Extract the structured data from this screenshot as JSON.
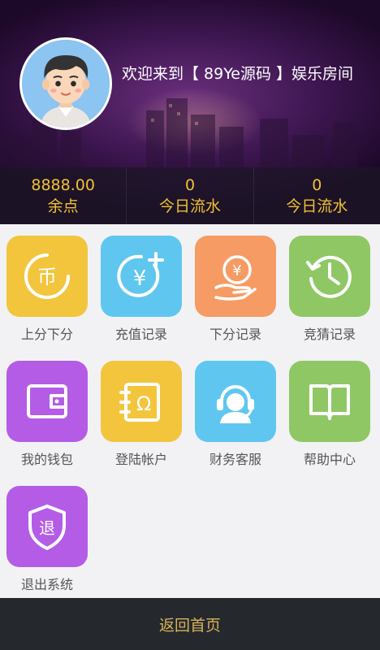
{
  "header": {
    "welcome": "欢迎来到【 89Ye源码 】娱乐房间"
  },
  "stats": [
    {
      "value": "8888.00",
      "label": "余点"
    },
    {
      "value": "0",
      "label": "今日流水"
    },
    {
      "value": "0",
      "label": "今日流水"
    }
  ],
  "menu": [
    {
      "label": "上分下分",
      "icon": "coin-icon",
      "color": "#f2c53d"
    },
    {
      "label": "充值记录",
      "icon": "yen-plus-icon",
      "color": "#5fc7ef"
    },
    {
      "label": "下分记录",
      "icon": "yen-hand-icon",
      "color": "#f69b63"
    },
    {
      "label": "竞猜记录",
      "icon": "clock-history-icon",
      "color": "#8fc765"
    },
    {
      "label": "我的钱包",
      "icon": "wallet-icon",
      "color": "#b45ce6"
    },
    {
      "label": "登陆帐户",
      "icon": "account-icon",
      "color": "#f2c53d"
    },
    {
      "label": "财务客服",
      "icon": "headset-icon",
      "color": "#5fc7ef"
    },
    {
      "label": "帮助中心",
      "icon": "book-icon",
      "color": "#8fc765"
    },
    {
      "label": "退出系统",
      "icon": "logout-shield-icon",
      "color": "#b45ce6"
    }
  ],
  "icon_glyphs": {
    "coin": "币",
    "yen": "¥",
    "account": "Ω",
    "logout": "退"
  },
  "footer": {
    "back_home": "返回首页"
  }
}
